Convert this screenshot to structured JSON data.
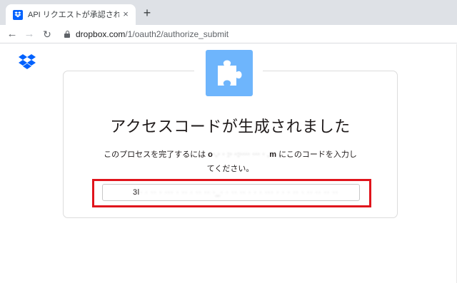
{
  "browser": {
    "tab_title": "API リクエストが承認されました - Dropbox",
    "url_host": "dropbox.com",
    "url_path": "/1/oauth2/authorize_submit",
    "new_tab_label": "+",
    "close_label": "×",
    "back_label": "←",
    "forward_label": "→",
    "reload_label": "↻"
  },
  "icons": {
    "favicon": "dropbox-icon",
    "logo": "dropbox-logo",
    "plugin": "puzzle-piece-icon",
    "lock": "lock-icon"
  },
  "colors": {
    "brand": "#0061fe",
    "plugin_tile": "#6eb5fc",
    "highlight": "#e0141c"
  },
  "page": {
    "heading": "アクセスコードが生成されました",
    "instruction_before": "このプロセスを完了するには ",
    "app_name_start": "o",
    "app_name_blurred": "·.·  ·  :·  ·:···· ··· · .",
    "app_name_end": "m",
    "instruction_after": " にこのコードを入力してください。",
    "code_start": "3l",
    "code_blurred": "·  ·  ··  ·  ··· ·  ·· · ··  ·· ·_· · ··  ·· ·  · ·  ··· · · ·  ··  ·  ·· ·· ·· ··"
  }
}
